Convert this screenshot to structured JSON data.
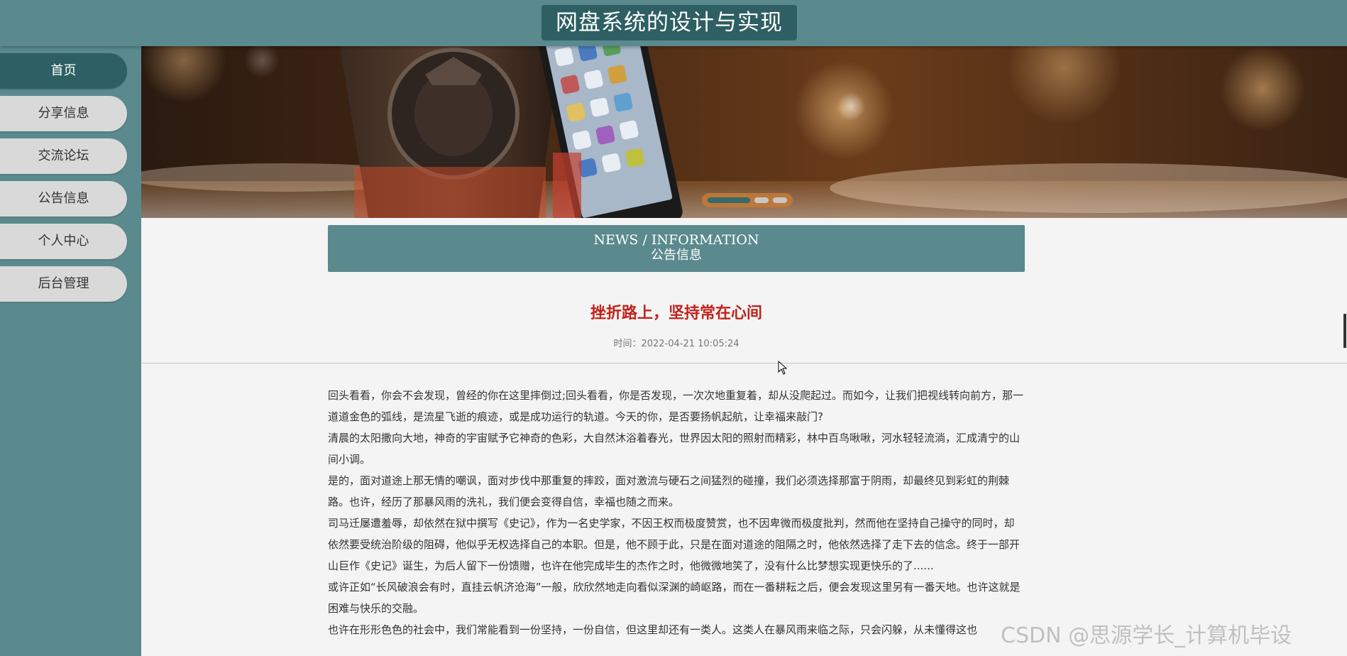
{
  "header": {
    "title": "网盘系统的设计与实现"
  },
  "sidebar": {
    "items": [
      {
        "label": "首页"
      },
      {
        "label": "分享信息"
      },
      {
        "label": "交流论坛"
      },
      {
        "label": "公告信息"
      },
      {
        "label": "个人中心"
      },
      {
        "label": "后台管理"
      }
    ]
  },
  "banner": {
    "active_slide": 1,
    "slide_count": 3
  },
  "section": {
    "title_en": "NEWS / INFORMATION",
    "title_cn": "公告信息"
  },
  "article": {
    "title": "挫折路上，坚持常在心间",
    "time": "时间：2022-04-21 10:05:24",
    "paragraphs": [
      "回头看看，你会不会发现，曾经的你在这里摔倒过;回头看看，你是否发现，一次次地重复着，却从没爬起过。而如今，让我们把视线转向前方，那一道道金色的弧线，是流星飞逝的痕迹，或是成功运行的轨道。今天的你，是否要扬帆起航，让幸福来敲门?",
      "清晨的太阳撒向大地，神奇的宇宙赋予它神奇的色彩，大自然沐浴着春光，世界因太阳的照射而精彩，林中百鸟啾啾，河水轻轻流淌，汇成清宁的山间小调。",
      "是的，面对道途上那无情的嘲讽，面对步伐中那重复的摔跤，面对激流与硬石之间猛烈的碰撞，我们必须选择那富于阴雨，却最终见到彩虹的荆棘路。也许，经历了那暴风雨的洗礼，我们便会变得自信，幸福也随之而来。",
      "司马迁屡遭羞辱，却依然在狱中撰写《史记》，作为一名史学家，不因王权而极度赞赏，也不因卑微而极度批判，然而他在坚持自己操守的同时，却依然要受统治阶级的阻碍，他似乎无权选择自己的本职。但是，他不顾于此，只是在面对道途的阻隔之时，他依然选择了走下去的信念。终于一部开山巨作《史记》诞生，为后人留下一份馈赠，也许在他完成毕生的杰作之时，他微微地笑了，没有什么比梦想实现更快乐的了......",
      "或许正如“长风破浪会有时，直挂云帆济沧海”一般，欣欣然地走向看似深渊的崎岖路，而在一番耕耘之后，便会发现这里另有一番天地。也许这就是困难与快乐的交融。",
      "也许在形形色色的社会中，我们常能看到一份坚持，一份自信，但这里却还有一类人。这类人在暴风雨来临之际，只会闪躲，从未懂得这也"
    ]
  },
  "watermark": {
    "text": "CSDN @思源学长_计算机毕设"
  }
}
